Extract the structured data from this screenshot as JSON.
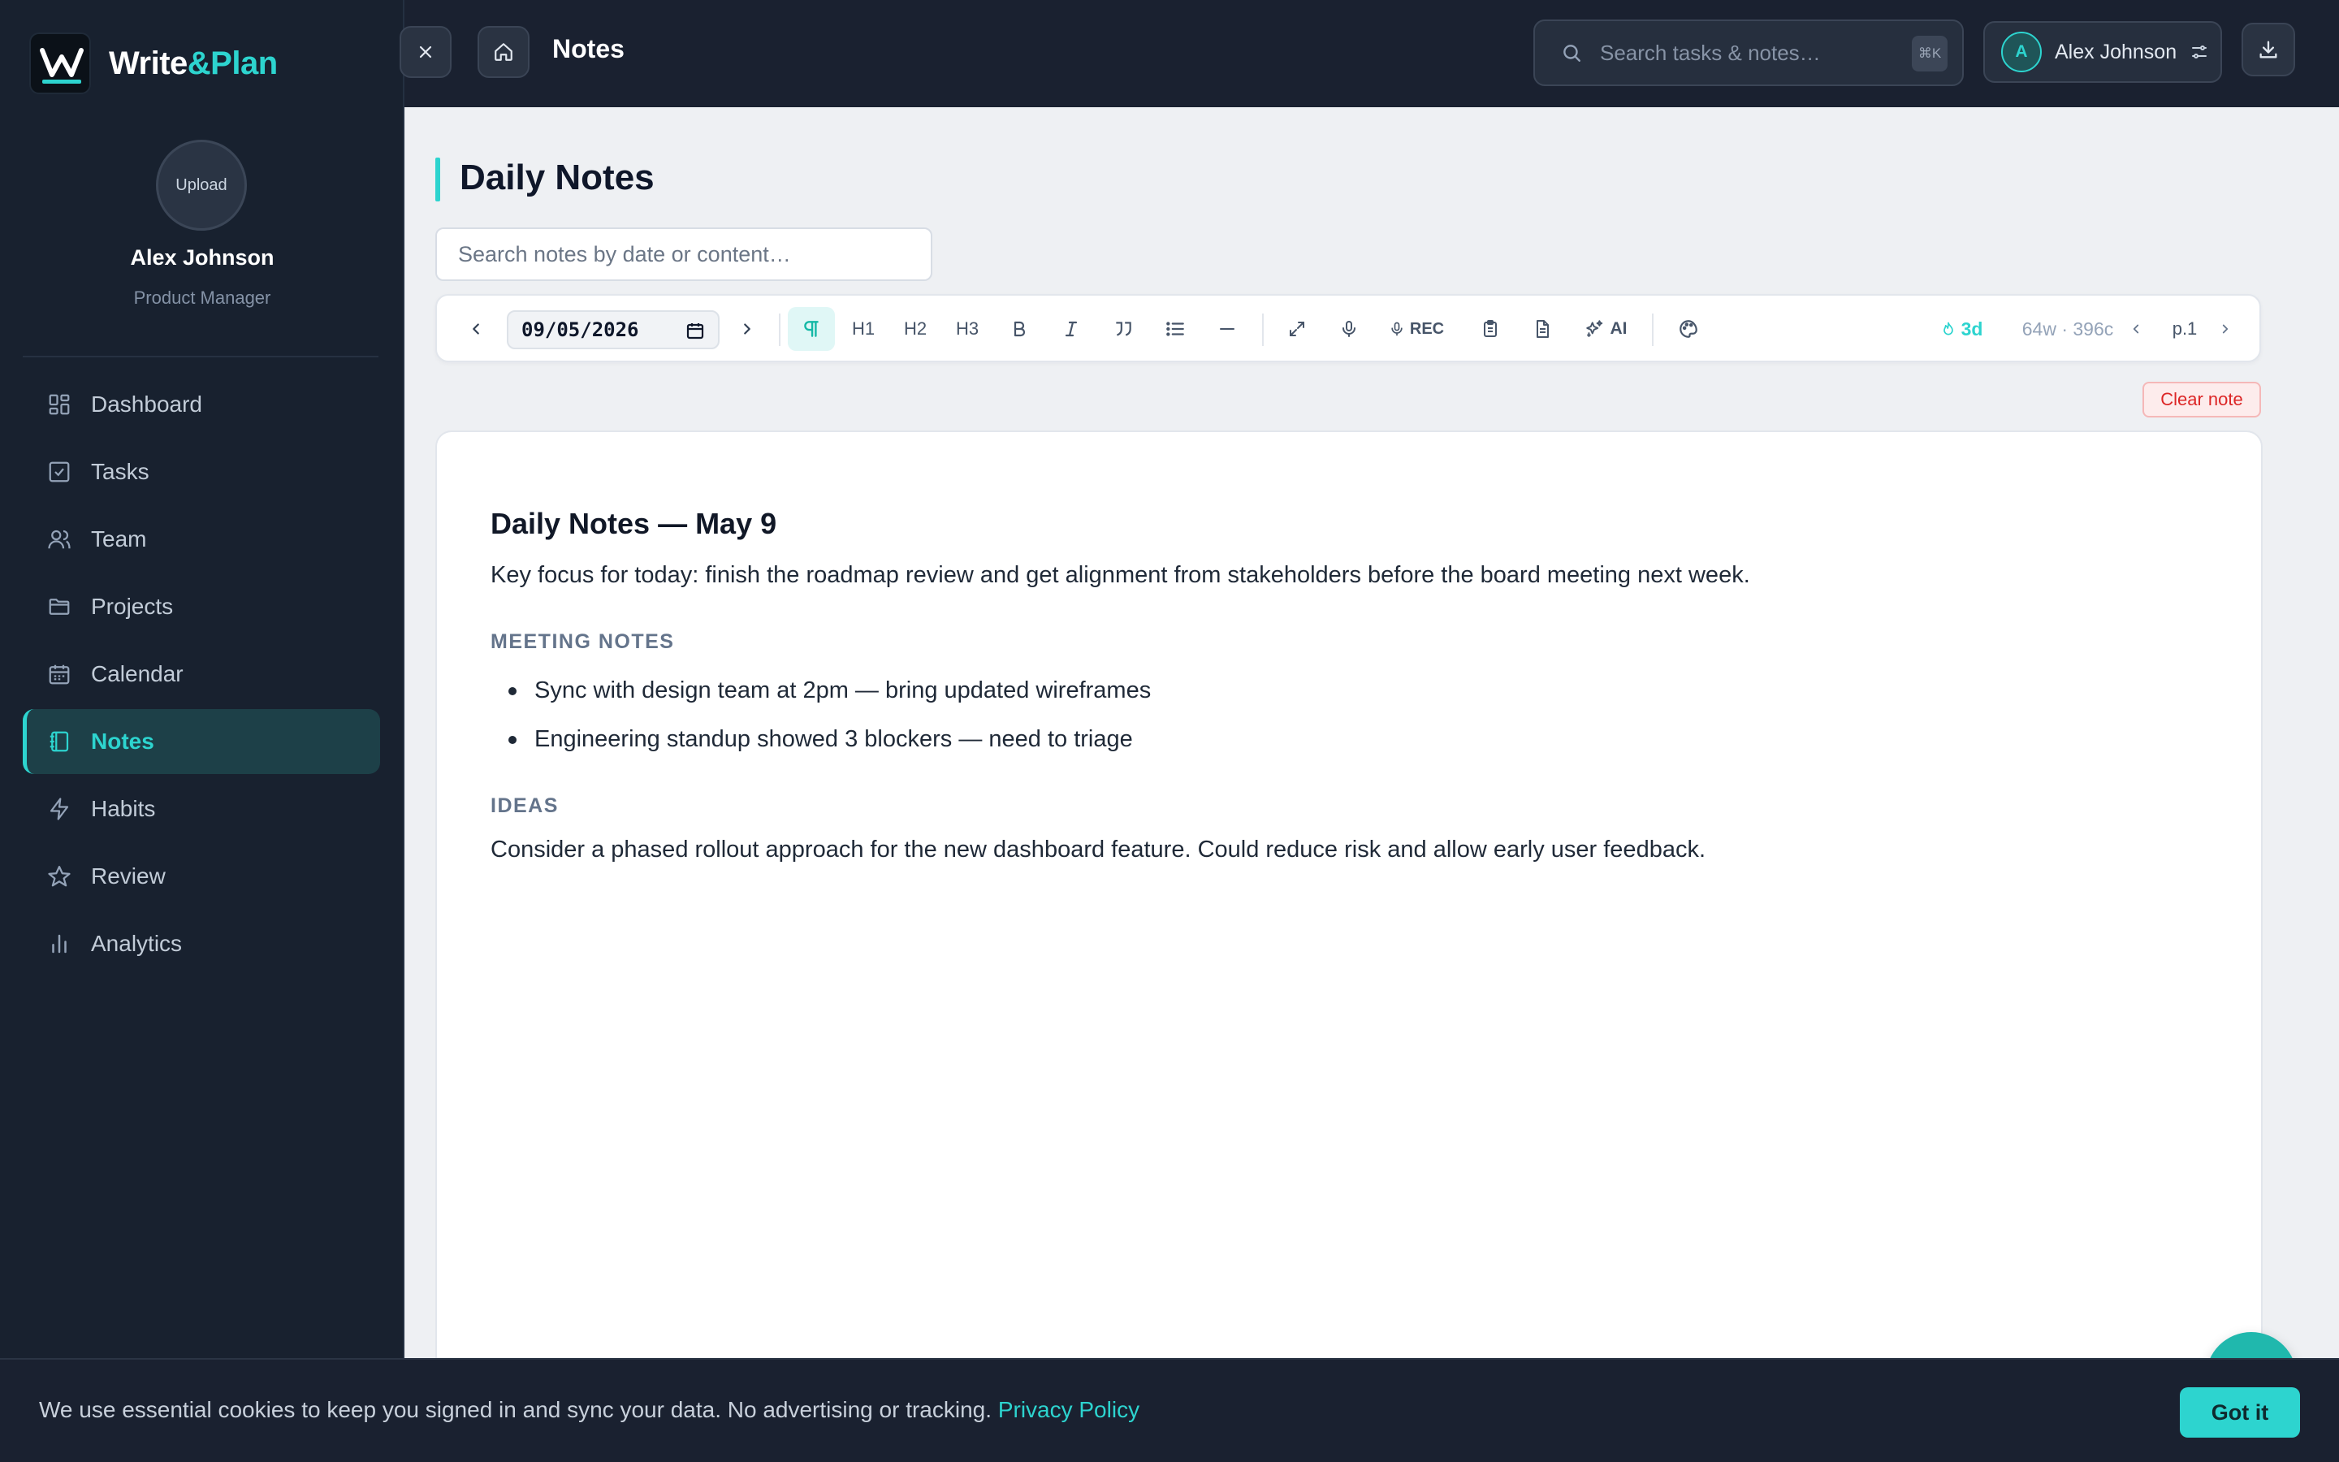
{
  "brand": {
    "name_part1": "Write",
    "name_part2": "&Plan"
  },
  "sidebar": {
    "upload_label": "Upload",
    "user_name": "Alex Johnson",
    "user_role": "Product Manager",
    "items": [
      {
        "label": "Dashboard",
        "icon": "grid-icon"
      },
      {
        "label": "Tasks",
        "icon": "check-square-icon"
      },
      {
        "label": "Team",
        "icon": "users-icon"
      },
      {
        "label": "Projects",
        "icon": "folder-icon"
      },
      {
        "label": "Calendar",
        "icon": "calendar-icon"
      },
      {
        "label": "Notes",
        "icon": "notebook-icon",
        "active": true
      },
      {
        "label": "Habits",
        "icon": "zap-icon"
      },
      {
        "label": "Review",
        "icon": "star-icon"
      },
      {
        "label": "Analytics",
        "icon": "bar-chart-icon"
      }
    ]
  },
  "topbar": {
    "title": "Notes",
    "search_placeholder": "Search tasks & notes…",
    "search_shortcut": "⌘K",
    "user_initial": "A",
    "user_name": "Alex Johnson"
  },
  "main": {
    "page_title": "Daily Notes",
    "search_placeholder": "Search notes by date or content…",
    "toolbar": {
      "date_value": "09/05/2026",
      "h1": "H1",
      "h2": "H2",
      "h3": "H3",
      "rec_label": "REC",
      "ai_label": "AI",
      "streak": "3d",
      "counts": "64w · 396c",
      "page": "p.1"
    },
    "clear_label": "Clear note",
    "editor": {
      "heading": "Daily Notes — May 9",
      "intro": "Key focus for today: finish the roadmap review and get alignment from stakeholders before the board meeting next week.",
      "section1": "MEETING NOTES",
      "bullets": [
        "Sync with design team at 2pm — bring updated wireframes",
        "Engineering standup showed 3 blockers — need to triage"
      ],
      "section2": "IDEAS",
      "ideas_text": "Consider a phased rollout approach for the new dashboard feature. Could reduce risk and allow early user feedback."
    }
  },
  "cookie": {
    "text": "We use essential cookies to keep you signed in and sync your data. No advertising or tracking.",
    "link": "Privacy Policy",
    "button": "Got it"
  },
  "colors": {
    "accent": "#2dd4cf",
    "sidebar_bg": "#18212f",
    "topbar_bg": "#1a2130",
    "danger": "#dc2626"
  }
}
